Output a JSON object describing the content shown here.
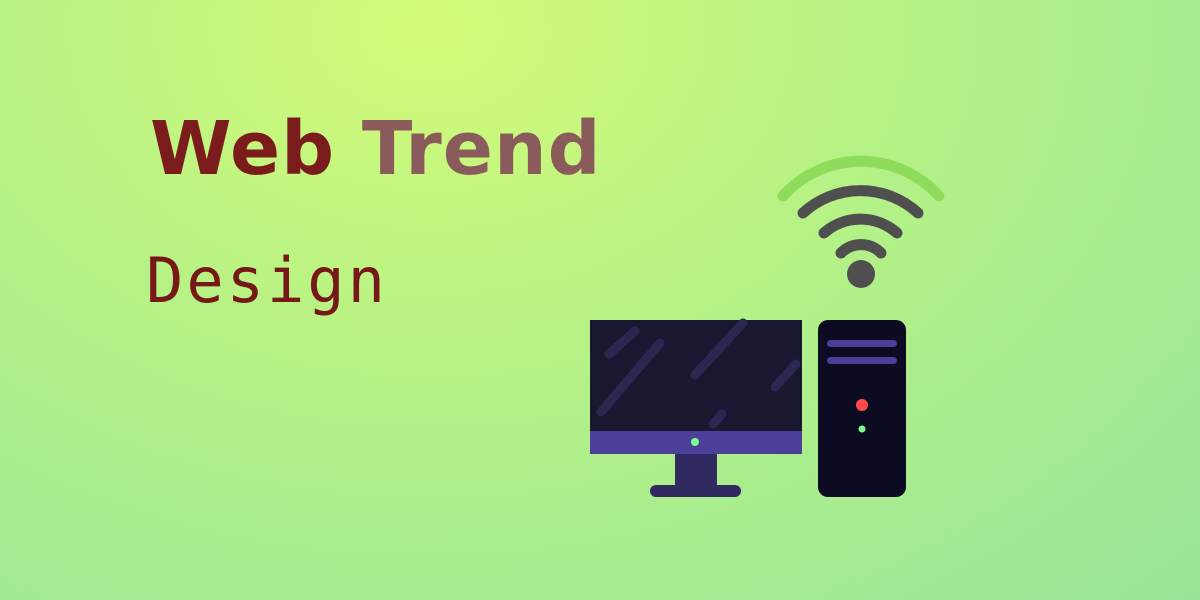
{
  "headline": {
    "word1": "Web",
    "word2": "Trend",
    "subtitle": "Design"
  },
  "icons": {
    "wifi": "wifi-icon",
    "monitor": "monitor-icon",
    "tower": "computer-tower-icon"
  },
  "colors": {
    "title_primary": "#7a1c1c",
    "title_secondary": "#8a5b5b",
    "subtitle": "#761818",
    "wifi_outer": "#8fdc5c",
    "wifi_inner": "#4f4f4f",
    "screen": "#1a1830",
    "bezel": "#4b3f9a",
    "tower_body": "#0c0b22",
    "power_led": "#ff4a4a",
    "status_led": "#7cff8c"
  }
}
